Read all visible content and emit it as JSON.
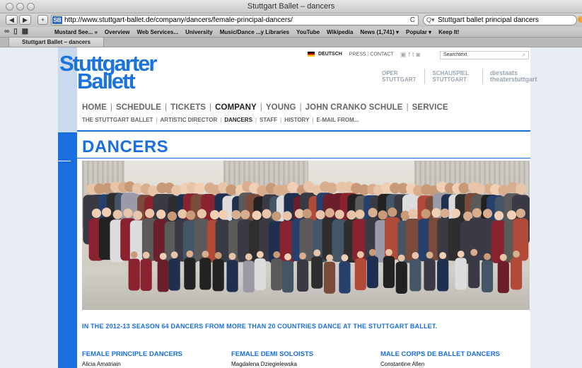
{
  "window": {
    "title": "Stuttgart Ballet – dancers"
  },
  "toolbar": {
    "back": "◀",
    "forward": "▶",
    "add": "+",
    "site_icon": "SB",
    "url": "http://www.stuttgart-ballet.de/company/dancers/female-principal-dancers/",
    "reload": "C",
    "search_value": "Stuttgart ballet principal dancers"
  },
  "bookmarks": {
    "items": [
      "Mustard See... »",
      "Overview",
      "Web Services...",
      "University",
      "Music/Dance ...y Libraries",
      "YouTube",
      "Wikipedia",
      "News (1,741) ▾",
      "Popular ▾",
      "Keep It!"
    ]
  },
  "tab": {
    "label": "Stuttgart Ballet – dancers"
  },
  "site": {
    "logo_line1": "Stuttgarter",
    "logo_line2": "Ballett",
    "lang": "DEUTSCH",
    "press": "PRESS",
    "contact": "CONTACT",
    "search_placeholder": "Searchtext",
    "partner1": "OPER STUTTGART",
    "partner2": "SCHAUSPIEL STUTTGART",
    "partner3": "diestaats theaterstuttgart"
  },
  "mainnav": [
    "HOME",
    "SCHEDULE",
    "TICKETS",
    "COMPANY",
    "YOUNG",
    "JOHN CRANKO SCHULE",
    "SERVICE"
  ],
  "subnav": [
    "THE STUTTGART BALLET",
    "ARTISTIC DIRECTOR",
    "DANCERS",
    "STAFF",
    "HISTORY",
    "E-MAIL FROM..."
  ],
  "page": {
    "heading": "DANCERS",
    "season_text": "IN THE 2012-13 SEASON 64 DANCERS FROM MORE THAN 20 COUNTRIES DANCE AT THE STUTTGART BALLET."
  },
  "columns": [
    {
      "heading": "FEMALE PRINCIPLE DANCERS",
      "first": "Alicia Amatriain"
    },
    {
      "heading": "FEMALE DEMI SOLOISTS",
      "first": "Magdalena Dziegielewska"
    },
    {
      "heading": "MALE CORPS DE BALLET DANCERS",
      "first": "Constantine Allen"
    }
  ],
  "colors": {
    "brand_blue": "#1a6fe0",
    "stripe_light": "#c9d9ee"
  }
}
